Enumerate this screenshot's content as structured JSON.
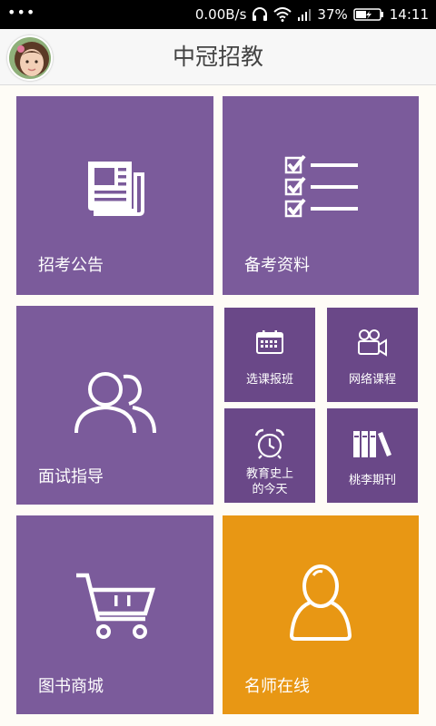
{
  "status_bar": {
    "notification": "•••",
    "net_speed": "0.00B/s",
    "battery": "37%",
    "time": "14:11"
  },
  "header": {
    "title": "中冠招教"
  },
  "colors": {
    "tile_purple": "#7b5b9b",
    "tile_small_purple": "#6a4888",
    "tile_orange": "#e89714"
  },
  "tiles": {
    "recruit_notice": {
      "label": "招考公告",
      "icon": "newspaper-icon"
    },
    "prep_materials": {
      "label": "备考资料",
      "icon": "checklist-icon"
    },
    "interview_guide": {
      "label": "面试指导",
      "icon": "users-icon"
    },
    "class_select": {
      "label": "选课报班",
      "icon": "calendar-icon"
    },
    "online_course": {
      "label": "网络课程",
      "icon": "video-camera-icon"
    },
    "history_today": {
      "label_line1": "教育史上",
      "label_line2": "的今天",
      "icon": "alarm-clock-icon"
    },
    "journal": {
      "label": "桃李期刊",
      "icon": "books-icon"
    },
    "book_mall": {
      "label": "图书商城",
      "icon": "shopping-cart-icon"
    },
    "teacher_online": {
      "label": "名师在线",
      "icon": "person-icon"
    }
  }
}
